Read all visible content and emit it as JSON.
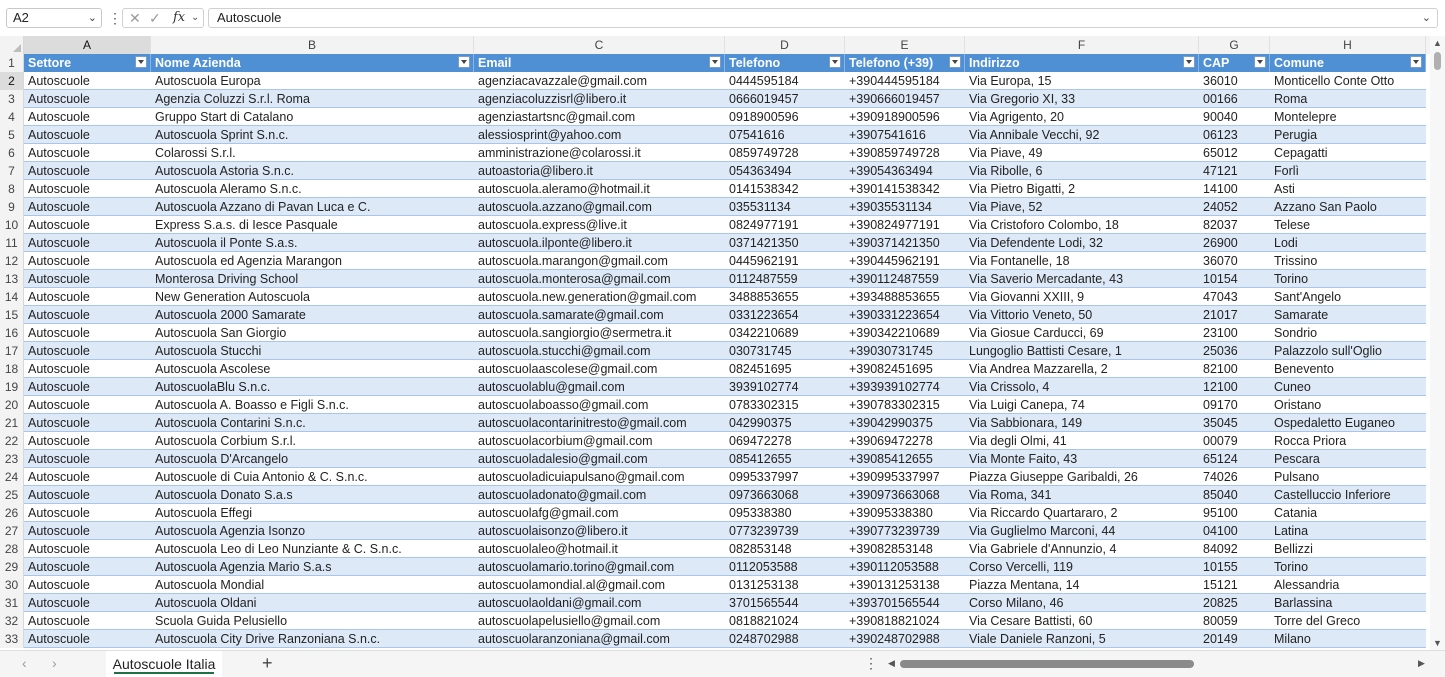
{
  "formula_bar": {
    "name_box": "A2",
    "formula": "Autoscuole",
    "fx": "fx"
  },
  "columns": [
    "A",
    "B",
    "C",
    "D",
    "E",
    "F",
    "G",
    "H"
  ],
  "headers": [
    "Settore",
    "Nome Azienda",
    "Email",
    "Telefono",
    "Telefono (+39)",
    "Indirizzo",
    "CAP",
    "Comune"
  ],
  "rows": [
    [
      "Autoscuole",
      "Autoscuola Europa",
      "agenziacavazzale@gmail.com",
      "0444595184",
      "+390444595184",
      "Via Europa, 15",
      "36010",
      "Monticello Conte Otto"
    ],
    [
      "Autoscuole",
      "Agenzia Coluzzi S.r.l. Roma",
      "agenziacoluzzisrl@libero.it",
      "0666019457",
      "+390666019457",
      "Via Gregorio XI, 33",
      "00166",
      "Roma"
    ],
    [
      "Autoscuole",
      "Gruppo Start di Catalano",
      "agenziastartsnc@gmail.com",
      "0918900596",
      "+390918900596",
      "Via Agrigento, 20",
      "90040",
      "Montelepre"
    ],
    [
      "Autoscuole",
      "Autoscuola Sprint S.n.c.",
      "alessiosprint@yahoo.com",
      "07541616",
      "+3907541616",
      "Via Annibale Vecchi, 92",
      "06123",
      "Perugia"
    ],
    [
      "Autoscuole",
      "Colarossi S.r.l.",
      "amministrazione@colarossi.it",
      "0859749728",
      "+390859749728",
      "Via Piave, 49",
      "65012",
      "Cepagatti"
    ],
    [
      "Autoscuole",
      "Autoscuola Astoria S.n.c.",
      "autoastoria@libero.it",
      "054363494",
      "+39054363494",
      "Via Ribolle, 6",
      "47121",
      "Forlì"
    ],
    [
      "Autoscuole",
      "Autoscuola Aleramo S.n.c.",
      "autoscuola.aleramo@hotmail.it",
      "0141538342",
      "+390141538342",
      "Via Pietro Bigatti, 2",
      "14100",
      "Asti"
    ],
    [
      "Autoscuole",
      "Autoscuola Azzano di Pavan Luca e C.",
      "autoscuola.azzano@gmail.com",
      "035531134",
      "+39035531134",
      "Via Piave, 52",
      "24052",
      "Azzano San Paolo"
    ],
    [
      "Autoscuole",
      "Express S.a.s. di Iesce Pasquale",
      "autoscuola.express@live.it",
      "0824977191",
      "+390824977191",
      "Via Cristoforo Colombo, 18",
      "82037",
      "Telese"
    ],
    [
      "Autoscuole",
      "Autoscuola il Ponte S.a.s.",
      "autoscuola.ilponte@libero.it",
      "0371421350",
      "+390371421350",
      "Via Defendente Lodi, 32",
      "26900",
      "Lodi"
    ],
    [
      "Autoscuole",
      "Autoscuola ed Agenzia Marangon",
      "autoscuola.marangon@gmail.com",
      "0445962191",
      "+390445962191",
      "Via Fontanelle, 18",
      "36070",
      "Trissino"
    ],
    [
      "Autoscuole",
      "Monterosa Driving School",
      "autoscuola.monterosa@gmail.com",
      "0112487559",
      "+390112487559",
      "Via Saverio Mercadante, 43",
      "10154",
      "Torino"
    ],
    [
      "Autoscuole",
      "New Generation Autoscuola",
      "autoscuola.new.generation@gmail.com",
      "3488853655",
      "+393488853655",
      "Via Giovanni XXIII, 9",
      "47043",
      "Sant'Angelo"
    ],
    [
      "Autoscuole",
      "Autoscuola 2000 Samarate",
      "autoscuola.samarate@gmail.com",
      "0331223654",
      "+390331223654",
      "Via Vittorio Veneto, 50",
      "21017",
      "Samarate"
    ],
    [
      "Autoscuole",
      "Autoscuola San Giorgio",
      "autoscuola.sangiorgio@sermetra.it",
      "0342210689",
      "+390342210689",
      "Via Giosue Carducci, 69",
      "23100",
      "Sondrio"
    ],
    [
      "Autoscuole",
      "Autoscuola Stucchi",
      "autoscuola.stucchi@gmail.com",
      "030731745",
      "+39030731745",
      "Lungoglio Battisti Cesare, 1",
      "25036",
      "Palazzolo sull'Oglio"
    ],
    [
      "Autoscuole",
      "Autoscuola Ascolese",
      "autoscuolaascolese@gmail.com",
      "082451695",
      "+39082451695",
      "Via Andrea Mazzarella, 2",
      "82100",
      "Benevento"
    ],
    [
      "Autoscuole",
      "AutoscuolaBlu S.n.c.",
      "autoscuolablu@gmail.com",
      "3939102774",
      "+393939102774",
      "Via Crissolo, 4",
      "12100",
      "Cuneo"
    ],
    [
      "Autoscuole",
      "Autoscuola A. Boasso e Figli S.n.c.",
      "autoscuolaboasso@gmail.com",
      "0783302315",
      "+390783302315",
      "Via Luigi Canepa, 74",
      "09170",
      "Oristano"
    ],
    [
      "Autoscuole",
      "Autoscuola Contarini S.n.c.",
      "autoscuolacontarinitresto@gmail.com",
      "042990375",
      "+39042990375",
      "Via Sabbionara, 149",
      "35045",
      "Ospedaletto Euganeo"
    ],
    [
      "Autoscuole",
      "Autoscuola Corbium S.r.l.",
      "autoscuolacorbium@gmail.com",
      "069472278",
      "+39069472278",
      "Via degli Olmi, 41",
      "00079",
      "Rocca Priora"
    ],
    [
      "Autoscuole",
      "Autoscuola D'Arcangelo",
      "autoscuoladalesio@gmail.com",
      "085412655",
      "+39085412655",
      "Via Monte Faito, 43",
      "65124",
      "Pescara"
    ],
    [
      "Autoscuole",
      "Autoscuole di Cuia Antonio & C. S.n.c.",
      "autoscuoladicuiapulsano@gmail.com",
      "0995337997",
      "+390995337997",
      "Piazza Giuseppe Garibaldi, 26",
      "74026",
      "Pulsano"
    ],
    [
      "Autoscuole",
      "Autoscuola Donato S.a.s",
      "autoscuoladonato@gmail.com",
      "0973663068",
      "+390973663068",
      "Via Roma, 341",
      "85040",
      "Castelluccio Inferiore"
    ],
    [
      "Autoscuole",
      "Autoscuola Effegi",
      "autoscuolafg@gmail.com",
      "095338380",
      "+39095338380",
      "Via Riccardo Quartararo, 2",
      "95100",
      "Catania"
    ],
    [
      "Autoscuole",
      "Autoscuola Agenzia Isonzo",
      "autoscuolaisonzo@libero.it",
      "0773239739",
      "+390773239739",
      "Via Guglielmo Marconi, 44",
      "04100",
      "Latina"
    ],
    [
      "Autoscuole",
      "Autoscuola Leo di Leo Nunziante & C. S.n.c.",
      "autoscuolaleo@hotmail.it",
      "082853148",
      "+39082853148",
      "Via Gabriele d'Annunzio, 4",
      "84092",
      "Bellizzi"
    ],
    [
      "Autoscuole",
      "Autoscuola Agenzia Mario S.a.s",
      "autoscuolamario.torino@gmail.com",
      "0112053588",
      "+390112053588",
      "Corso Vercelli, 119",
      "10155",
      "Torino"
    ],
    [
      "Autoscuole",
      "Autoscuola Mondial",
      "autoscuolamondial.al@gmail.com",
      "0131253138",
      "+390131253138",
      "Piazza Mentana, 14",
      "15121",
      "Alessandria"
    ],
    [
      "Autoscuole",
      "Autoscuola Oldani",
      "autoscuolaoldani@gmail.com",
      "3701565544",
      "+393701565544",
      "Corso Milano, 46",
      "20825",
      "Barlassina"
    ],
    [
      "Autoscuole",
      "Scuola Guida Pelusiello",
      "autoscuolapelusiello@gmail.com",
      "0818821024",
      "+390818821024",
      "Via Cesare Battisti, 60",
      "80059",
      "Torre del Greco"
    ],
    [
      "Autoscuole",
      "Autoscuola City Drive Ranzoniana S.n.c.",
      "autoscuolaranzoniana@gmail.com",
      "0248702988",
      "+390248702988",
      "Viale Daniele Ranzoni, 5",
      "20149",
      "Milano"
    ]
  ],
  "sheet_tab": "Autoscuole Italia",
  "add_sheet": "+",
  "colors": {
    "header_fill": "#4f8fd4",
    "band_fill": "#dde9f7",
    "accent": "#1e7145"
  },
  "icons": {
    "cancel": "close-icon",
    "enter": "check-icon",
    "add": "plus-icon"
  }
}
